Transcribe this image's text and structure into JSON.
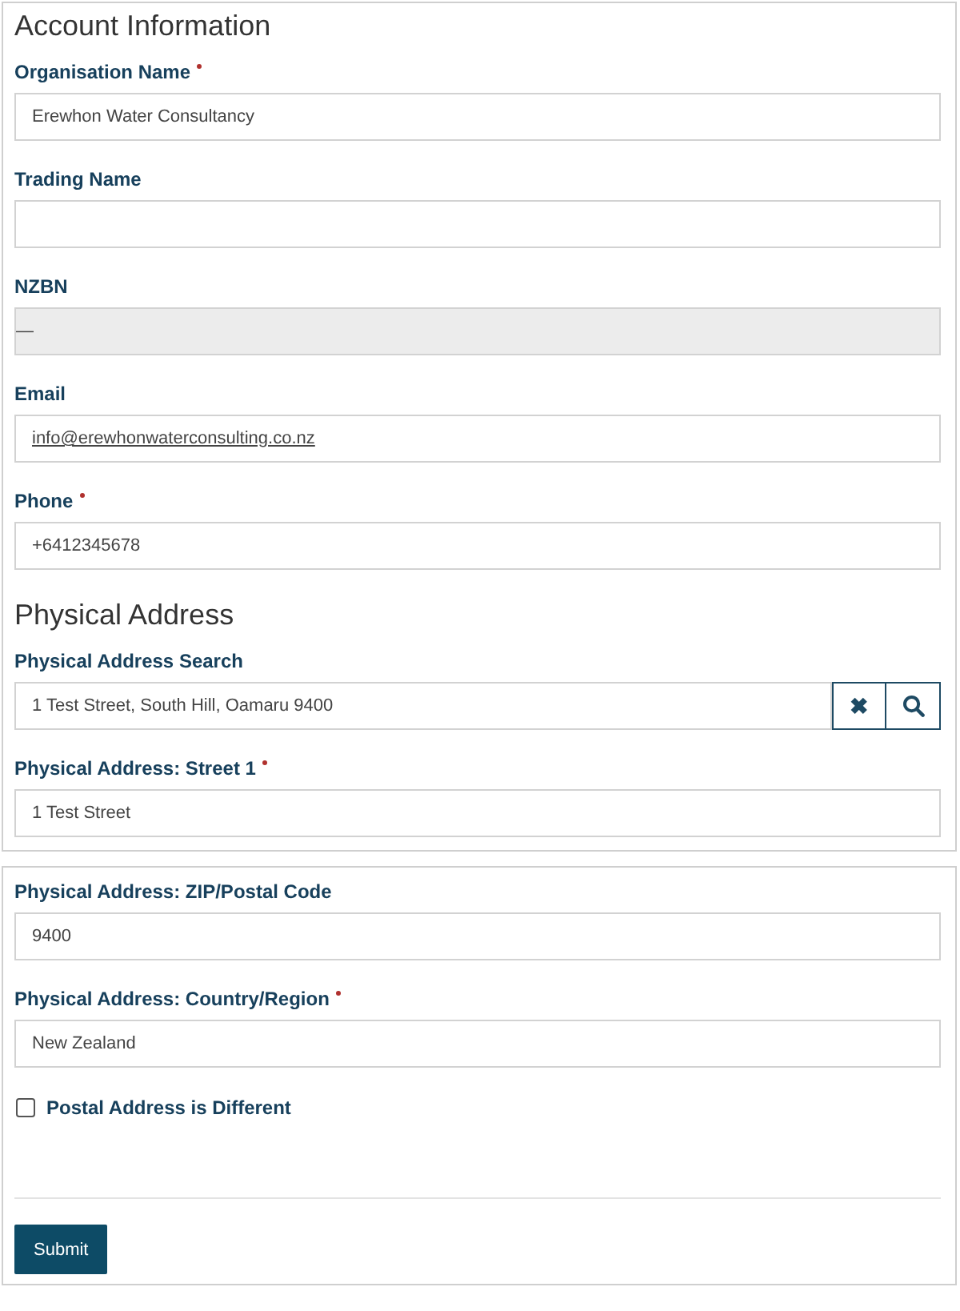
{
  "panels": [
    {
      "items": [
        {
          "kind": "heading",
          "text": "Account Information"
        },
        {
          "kind": "field",
          "label": "Organisation Name",
          "required": true,
          "value": "Erewhon Water Consultancy",
          "disabled": false,
          "link": false
        },
        {
          "kind": "field",
          "label": "Trading Name",
          "required": false,
          "disabled": false,
          "link": false
        },
        {
          "kind": "field",
          "label": "NZBN",
          "required": false,
          "value": "—",
          "disabled": true,
          "link": false
        },
        {
          "kind": "field",
          "label": "Email",
          "required": false,
          "value": "info@erewhonwaterconsulting.co.nz",
          "disabled": false,
          "link": true
        },
        {
          "kind": "field",
          "label": "Phone",
          "required": true,
          "value": "+6412345678",
          "disabled": false,
          "link": false
        },
        {
          "kind": "heading",
          "text": "Physical Address"
        },
        {
          "kind": "search",
          "label": "Physical Address Search",
          "required": false,
          "value": "1 Test Street, South Hill, Oamaru 9400",
          "clear_icon": "✖"
        },
        {
          "kind": "field",
          "label": "Physical Address: Street 1",
          "required": true,
          "value": "1 Test Street",
          "disabled": false,
          "link": false
        }
      ]
    },
    {
      "items": [
        {
          "kind": "field",
          "label": "Physical Address: ZIP/Postal Code",
          "required": false,
          "value": "9400",
          "disabled": false,
          "link": false
        },
        {
          "kind": "field",
          "label": "Physical Address: Country/Region",
          "required": true,
          "value": "New Zealand",
          "disabled": false,
          "link": false
        },
        {
          "kind": "checkbox",
          "label": "Postal Address is Different",
          "checked": false
        },
        {
          "kind": "divider"
        },
        {
          "kind": "button",
          "label": "Submit"
        }
      ]
    }
  ]
}
